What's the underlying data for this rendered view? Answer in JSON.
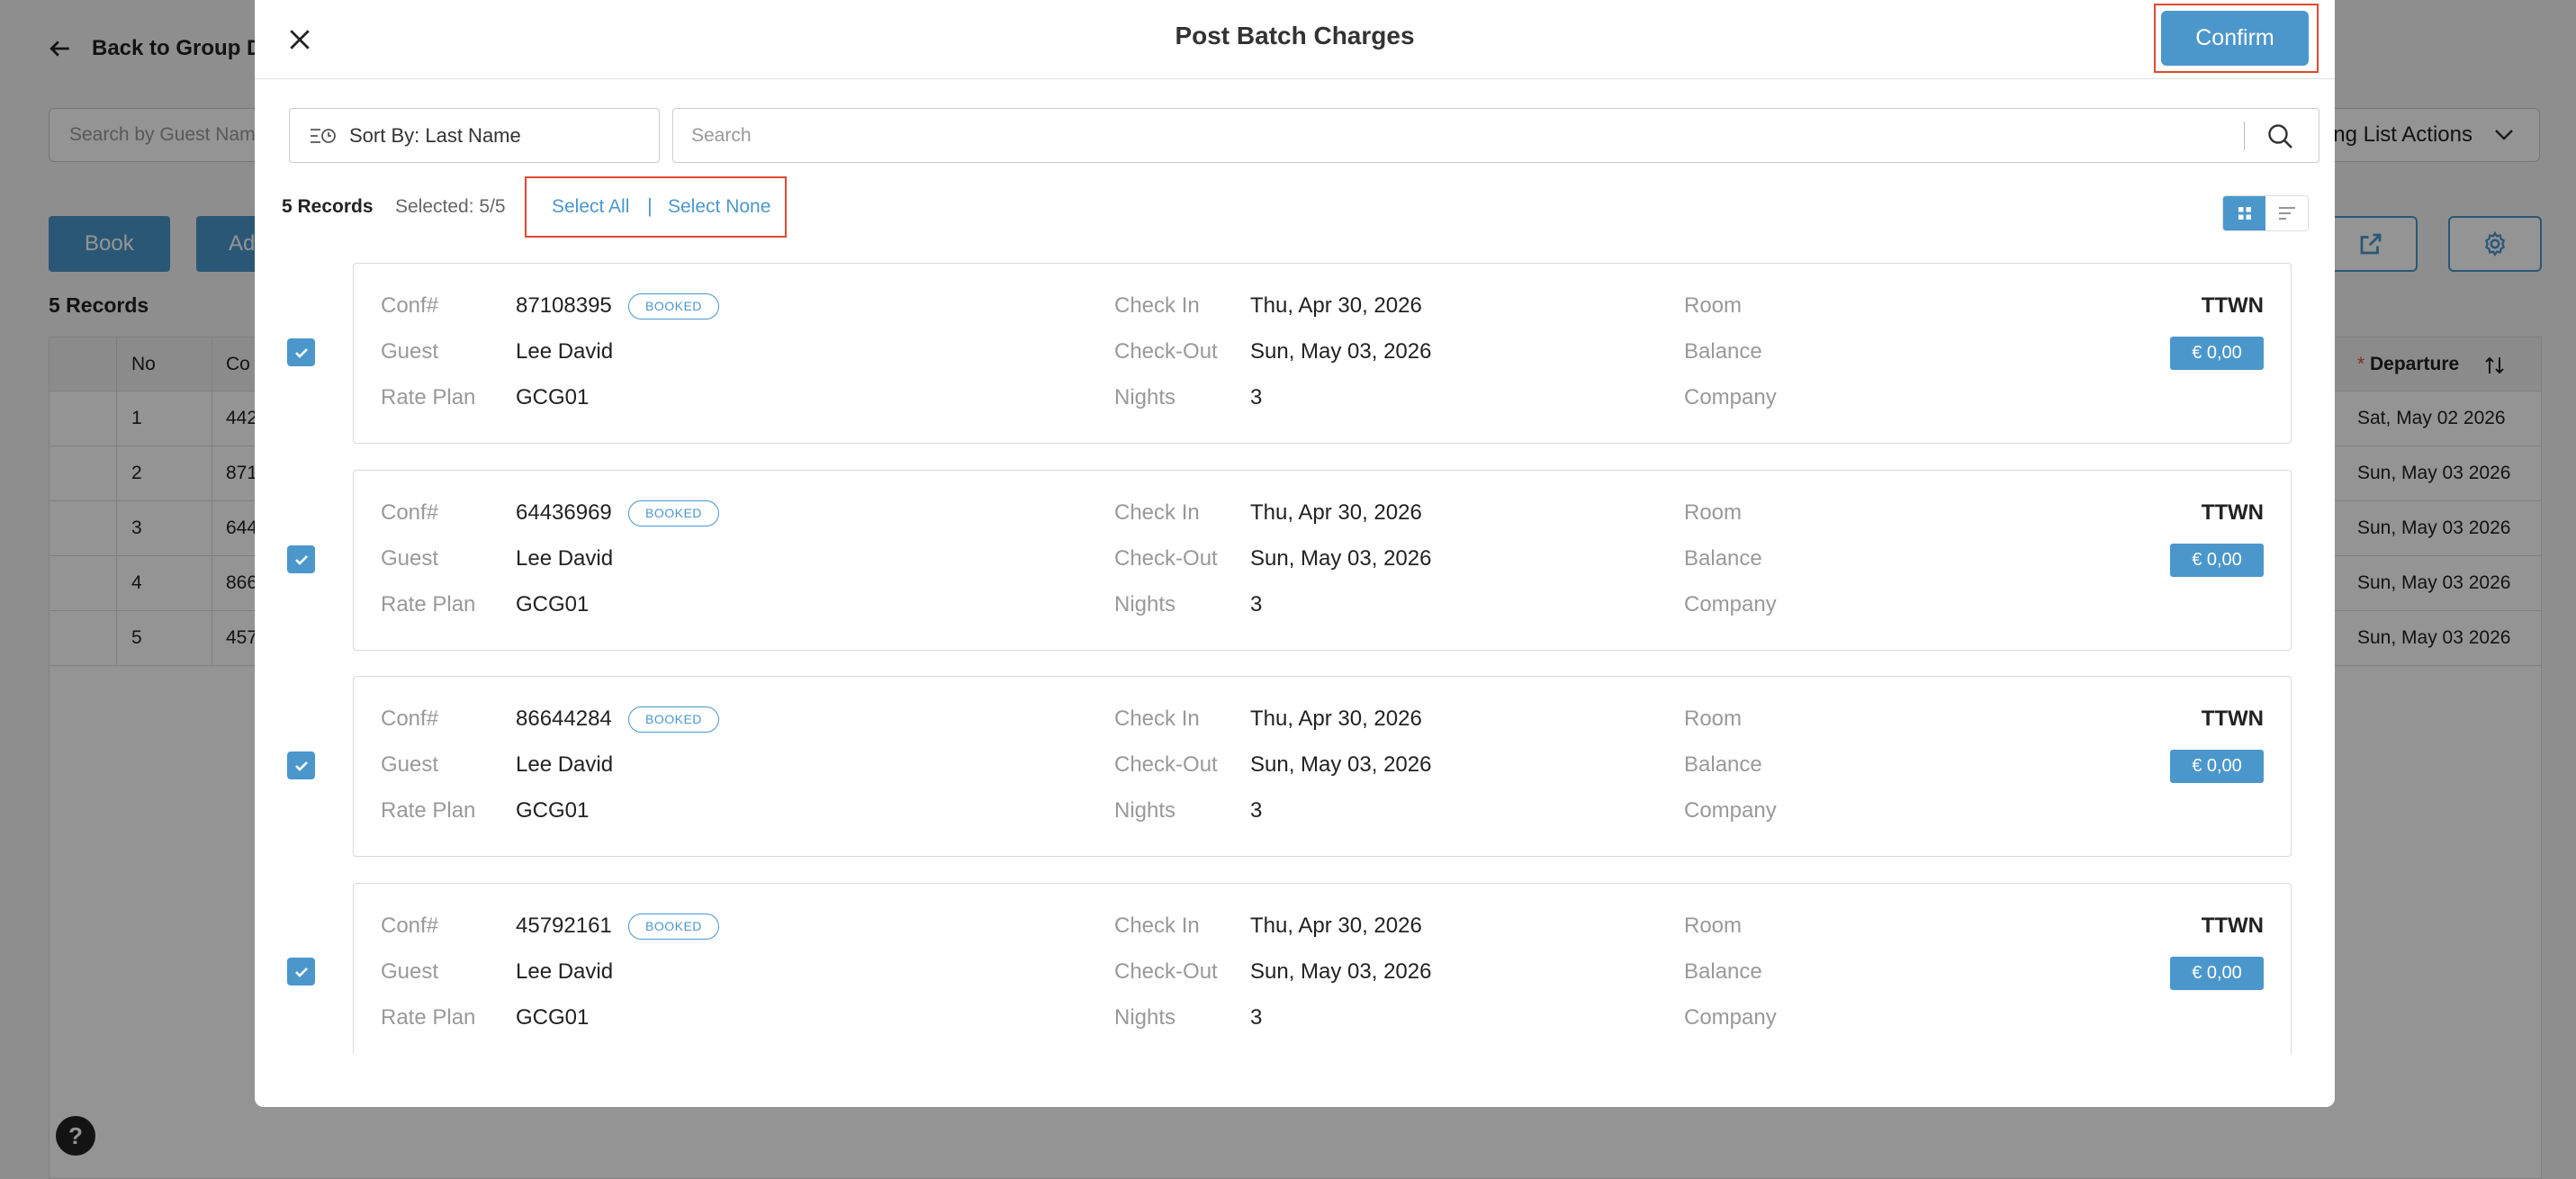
{
  "background": {
    "back_label": "Back to Group De",
    "search_placeholder": "Search by Guest Nam",
    "actions_label": "ng List Actions",
    "book_label": "Book",
    "add_label": "Ad",
    "record_count": "5 Records",
    "table": {
      "headers": {
        "no": "No",
        "conf": "Co",
        "departure": "Departure"
      },
      "departure_required": "*",
      "rows": [
        {
          "no": "1",
          "conf": "442",
          "departure": "Sat, May 02 2026"
        },
        {
          "no": "2",
          "conf": "871",
          "departure": "Sun, May 03 2026"
        },
        {
          "no": "3",
          "conf": "644",
          "departure": "Sun, May 03 2026"
        },
        {
          "no": "4",
          "conf": "866",
          "departure": "Sun, May 03 2026"
        },
        {
          "no": "5",
          "conf": "457",
          "departure": "Sun, May 03 2026"
        }
      ]
    },
    "help_label": "?"
  },
  "modal": {
    "title": "Post Batch Charges",
    "confirm_label": "Confirm",
    "sort_label": "Sort By: Last Name",
    "search_placeholder": "Search",
    "records_label": "5 Records",
    "selected_label": "Selected: 5/5",
    "select_all_label": "Select All",
    "separator": "|",
    "select_none_label": "Select None",
    "labels": {
      "conf": "Conf#",
      "guest": "Guest",
      "rate_plan": "Rate Plan",
      "check_in": "Check In",
      "check_out": "Check-Out",
      "nights": "Nights",
      "room": "Room",
      "balance": "Balance",
      "company": "Company"
    },
    "cards": [
      {
        "conf": "87108395",
        "status": "BOOKED",
        "guest": "Lee David",
        "rate_plan": "GCG01",
        "check_in": "Thu, Apr 30, 2026",
        "check_out": "Sun, May 03, 2026",
        "nights": "3",
        "room": "TTWN",
        "balance": "€ 0,00",
        "checked": true
      },
      {
        "conf": "64436969",
        "status": "BOOKED",
        "guest": "Lee David",
        "rate_plan": "GCG01",
        "check_in": "Thu, Apr 30, 2026",
        "check_out": "Sun, May 03, 2026",
        "nights": "3",
        "room": "TTWN",
        "balance": "€ 0,00",
        "checked": true
      },
      {
        "conf": "86644284",
        "status": "BOOKED",
        "guest": "Lee David",
        "rate_plan": "GCG01",
        "check_in": "Thu, Apr 30, 2026",
        "check_out": "Sun, May 03, 2026",
        "nights": "3",
        "room": "TTWN",
        "balance": "€ 0,00",
        "checked": true
      },
      {
        "conf": "45792161",
        "status": "BOOKED",
        "guest": "Lee David",
        "rate_plan": "GCG01",
        "check_in": "Thu, Apr 30, 2026",
        "check_out": "Sun, May 03, 2026",
        "nights": "3",
        "room": "TTWN",
        "balance": "€ 0,00",
        "checked": true
      }
    ]
  },
  "colors": {
    "accent": "#4b97cc",
    "highlight": "#e0492f"
  }
}
